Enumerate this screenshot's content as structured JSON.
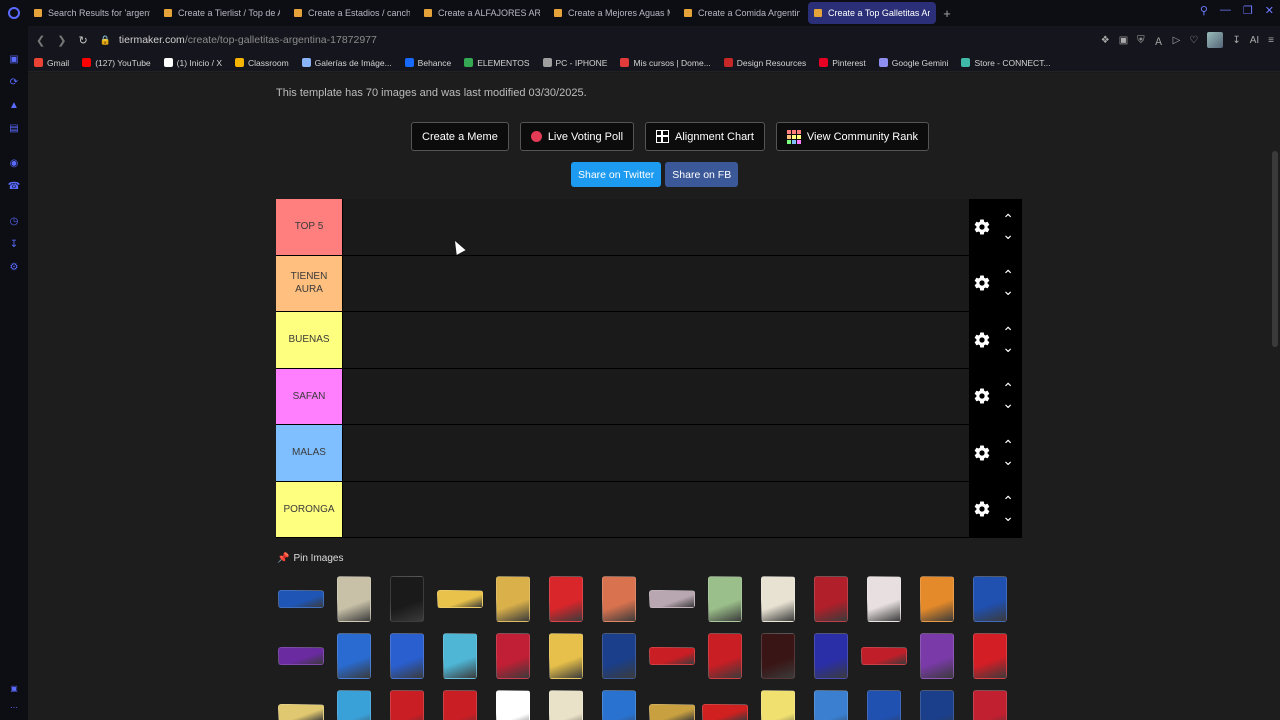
{
  "tabs": [
    {
      "label": "Search Results for 'argenti",
      "active": false
    },
    {
      "label": "Create a Tierlist / Top de A",
      "active": false
    },
    {
      "label": "Create a Estadios / cancha",
      "active": false
    },
    {
      "label": "Create a ALFAJORES ARG",
      "active": false
    },
    {
      "label": "Create a Mejores Aguas M",
      "active": false
    },
    {
      "label": "Create a Comida Argentin",
      "active": false
    },
    {
      "label": "Create a Top Galletitas Ar",
      "active": true
    }
  ],
  "address": {
    "domain": "tiermaker.com",
    "path": "/create/top-galletitas-argentina-17872977"
  },
  "right_icons": {
    "ai_label": "AI"
  },
  "bookmarks": [
    {
      "label": "Gmail",
      "color": "#ea4335"
    },
    {
      "label": "(127) YouTube",
      "color": "#ff0000"
    },
    {
      "label": "(1) Inicio / X",
      "color": "#ffffff"
    },
    {
      "label": "Classroom",
      "color": "#f4b400"
    },
    {
      "label": "Galerías de Imáge...",
      "color": "#8ab4f8"
    },
    {
      "label": "Behance",
      "color": "#1769ff"
    },
    {
      "label": "ELEMENTOS",
      "color": "#34a853"
    },
    {
      "label": "PC - IPHONE",
      "color": "#9e9e9e"
    },
    {
      "label": "Mis cursos | Dome...",
      "color": "#e23b3b"
    },
    {
      "label": "Design Resources",
      "color": "#c62828"
    },
    {
      "label": "Pinterest",
      "color": "#e60023"
    },
    {
      "label": "Google Gemini",
      "color": "#8e8ef0"
    },
    {
      "label": "Store - CONNECT...",
      "color": "#3fb9a8"
    }
  ],
  "page": {
    "info": "This template has 70 images and was last modified 03/30/2025.",
    "buttons": {
      "meme": "Create a Meme",
      "poll": "Live Voting Poll",
      "alignment": "Alignment Chart",
      "community": "View Community Rank"
    },
    "share": {
      "twitter": "Share on Twitter",
      "fb": "Share on FB"
    },
    "pin_label": "Pin Images"
  },
  "tiers": [
    {
      "label": "TOP 5",
      "color": "#ff7f7f"
    },
    {
      "label": "TIENEN AURA",
      "color": "#ffbf7f"
    },
    {
      "label": "BUENAS",
      "color": "#ffff7f"
    },
    {
      "label": "SAFAN",
      "color": "#ff7fff"
    },
    {
      "label": "MALAS",
      "color": "#7fbfff"
    },
    {
      "label": "PORONGA",
      "color": "#ffff7f"
    }
  ],
  "gallery_colors": [
    "#1f56b5",
    "#c8c1a8",
    "#1a1a1a",
    "#e8c24a",
    "#d9b04a",
    "#d8262b",
    "#d9734f",
    "#b8a6b0",
    "#9bbf8a",
    "#e8e2d2",
    "#b01f2a",
    "#e8e0e0",
    "#e48a2a",
    "#2050b0",
    "#6a2ba0",
    "#2a6bd1",
    "#2a5fd0",
    "#4fb6d6",
    "#c01f35",
    "#e6c04a",
    "#1b3f8a",
    "#c81e24",
    "#c81e24",
    "#3a1515",
    "#2a2fa8",
    "#c01f2a",
    "#7a3aa8",
    "#d41e26",
    "#e0c870",
    "#3aa0d8",
    "#c81e24",
    "#c81e24",
    "#ffffff",
    "#eae2c8",
    "#2a72d0",
    "#c8a040",
    "#d02020",
    "#f0e070",
    "#3a7fd0",
    "#2050b0",
    "#1b3f8a",
    "#c02030"
  ]
}
